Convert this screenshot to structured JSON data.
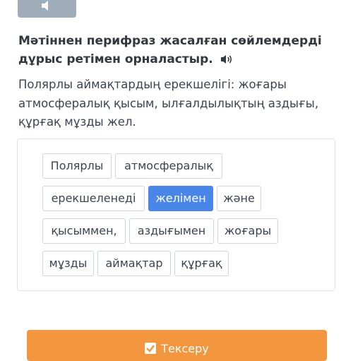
{
  "heading": "Мәтіннен перифраз жасалған сөйлемдерді дұрыс ретімен орналастыр.",
  "prompt": "Полярлы аймақтардың ерекшелігі: жоғары атмосфералық қысым, ылғалдылықтың аздығы, құрғақ мұзды жел.",
  "words": [
    {
      "label": "Полярлы",
      "selected": false
    },
    {
      "label": "атмосфералық",
      "selected": false
    },
    {
      "label": "ерекшеленеді",
      "selected": false
    },
    {
      "label": "желімен",
      "selected": true
    },
    {
      "label": "және",
      "selected": false
    },
    {
      "label": "қысыммен,",
      "selected": false
    },
    {
      "label": "аздығымен",
      "selected": false
    },
    {
      "label": "жоғары",
      "selected": false
    },
    {
      "label": "мұзды",
      "selected": false
    },
    {
      "label": "аймақтар",
      "selected": false
    },
    {
      "label": "құрғақ",
      "selected": false
    }
  ],
  "check_button": "Тексеру",
  "icons": {
    "top_audio": "speaker-icon",
    "heading_audio": "speaker-icon",
    "check": "checkmark-icon"
  },
  "colors": {
    "selected_chip": "#4a86e8",
    "check_button": "#f4963e",
    "top_audio_button": "#9fadbb"
  }
}
